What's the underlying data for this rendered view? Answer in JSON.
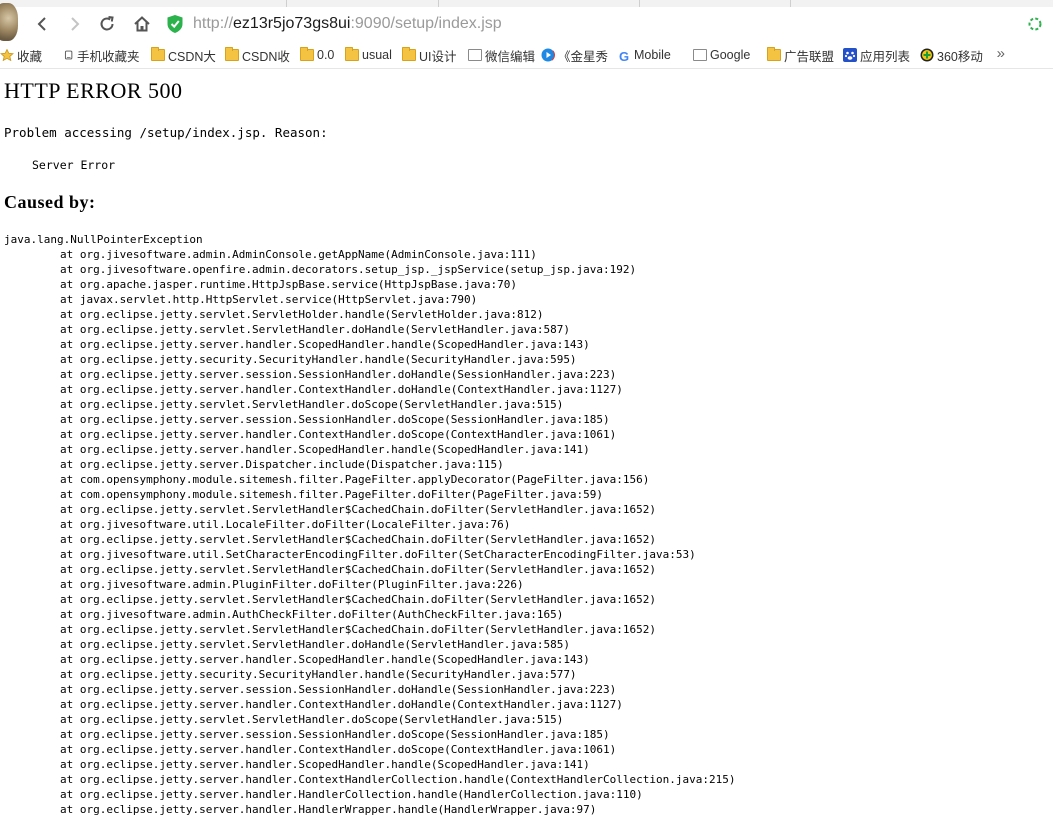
{
  "browser": {
    "url_prefix": "http://",
    "url_host": "ez13r5jo73gs8ui",
    "url_path": ":9090/setup/index.jsp"
  },
  "bookmarks": {
    "items": [
      {
        "label": "收藏",
        "icon": "star-icon"
      },
      {
        "label": "手机收藏夹",
        "icon": "phone-icon"
      },
      {
        "label": "CSDN大",
        "icon": "folder-icon"
      },
      {
        "label": "CSDN收",
        "icon": "folder-icon"
      },
      {
        "label": "0.0",
        "icon": "folder-icon"
      },
      {
        "label": "usual",
        "icon": "folder-icon"
      },
      {
        "label": "UI设计",
        "icon": "folder-icon"
      },
      {
        "label": "微信编辑",
        "icon": "page-icon"
      },
      {
        "label": "《金星秀",
        "icon": "circle-play-icon"
      },
      {
        "label": "Mobile",
        "icon": "google-icon"
      },
      {
        "label": "Google",
        "icon": "page-icon"
      },
      {
        "label": "广告联盟",
        "icon": "folder-icon"
      },
      {
        "label": "应用列表",
        "icon": "paw-icon"
      },
      {
        "label": "360移动",
        "icon": "plus-circle-icon"
      }
    ],
    "more_label": "»"
  },
  "page": {
    "title": "HTTP ERROR 500",
    "reason": "Problem accessing /setup/index.jsp. Reason:",
    "error_message": "Server Error",
    "caused_by": "Caused by:",
    "exception": "java.lang.NullPointerException",
    "stack": [
      "at org.jivesoftware.admin.AdminConsole.getAppName(AdminConsole.java:111)",
      "at org.jivesoftware.openfire.admin.decorators.setup_jsp._jspService(setup_jsp.java:192)",
      "at org.apache.jasper.runtime.HttpJspBase.service(HttpJspBase.java:70)",
      "at javax.servlet.http.HttpServlet.service(HttpServlet.java:790)",
      "at org.eclipse.jetty.servlet.ServletHolder.handle(ServletHolder.java:812)",
      "at org.eclipse.jetty.servlet.ServletHandler.doHandle(ServletHandler.java:587)",
      "at org.eclipse.jetty.server.handler.ScopedHandler.handle(ScopedHandler.java:143)",
      "at org.eclipse.jetty.security.SecurityHandler.handle(SecurityHandler.java:595)",
      "at org.eclipse.jetty.server.session.SessionHandler.doHandle(SessionHandler.java:223)",
      "at org.eclipse.jetty.server.handler.ContextHandler.doHandle(ContextHandler.java:1127)",
      "at org.eclipse.jetty.servlet.ServletHandler.doScope(ServletHandler.java:515)",
      "at org.eclipse.jetty.server.session.SessionHandler.doScope(SessionHandler.java:185)",
      "at org.eclipse.jetty.server.handler.ContextHandler.doScope(ContextHandler.java:1061)",
      "at org.eclipse.jetty.server.handler.ScopedHandler.handle(ScopedHandler.java:141)",
      "at org.eclipse.jetty.server.Dispatcher.include(Dispatcher.java:115)",
      "at com.opensymphony.module.sitemesh.filter.PageFilter.applyDecorator(PageFilter.java:156)",
      "at com.opensymphony.module.sitemesh.filter.PageFilter.doFilter(PageFilter.java:59)",
      "at org.eclipse.jetty.servlet.ServletHandler$CachedChain.doFilter(ServletHandler.java:1652)",
      "at org.jivesoftware.util.LocaleFilter.doFilter(LocaleFilter.java:76)",
      "at org.eclipse.jetty.servlet.ServletHandler$CachedChain.doFilter(ServletHandler.java:1652)",
      "at org.jivesoftware.util.SetCharacterEncodingFilter.doFilter(SetCharacterEncodingFilter.java:53)",
      "at org.eclipse.jetty.servlet.ServletHandler$CachedChain.doFilter(ServletHandler.java:1652)",
      "at org.jivesoftware.admin.PluginFilter.doFilter(PluginFilter.java:226)",
      "at org.eclipse.jetty.servlet.ServletHandler$CachedChain.doFilter(ServletHandler.java:1652)",
      "at org.jivesoftware.admin.AuthCheckFilter.doFilter(AuthCheckFilter.java:165)",
      "at org.eclipse.jetty.servlet.ServletHandler$CachedChain.doFilter(ServletHandler.java:1652)",
      "at org.eclipse.jetty.servlet.ServletHandler.doHandle(ServletHandler.java:585)",
      "at org.eclipse.jetty.server.handler.ScopedHandler.handle(ScopedHandler.java:143)",
      "at org.eclipse.jetty.security.SecurityHandler.handle(SecurityHandler.java:577)",
      "at org.eclipse.jetty.server.session.SessionHandler.doHandle(SessionHandler.java:223)",
      "at org.eclipse.jetty.server.handler.ContextHandler.doHandle(ContextHandler.java:1127)",
      "at org.eclipse.jetty.servlet.ServletHandler.doScope(ServletHandler.java:515)",
      "at org.eclipse.jetty.server.session.SessionHandler.doScope(SessionHandler.java:185)",
      "at org.eclipse.jetty.server.handler.ContextHandler.doScope(ContextHandler.java:1061)",
      "at org.eclipse.jetty.server.handler.ScopedHandler.handle(ScopedHandler.java:141)",
      "at org.eclipse.jetty.server.handler.ContextHandlerCollection.handle(ContextHandlerCollection.java:215)",
      "at org.eclipse.jetty.server.handler.HandlerCollection.handle(HandlerCollection.java:110)",
      "at org.eclipse.jetty.server.handler.HandlerWrapper.handle(HandlerWrapper.java:97)"
    ]
  }
}
